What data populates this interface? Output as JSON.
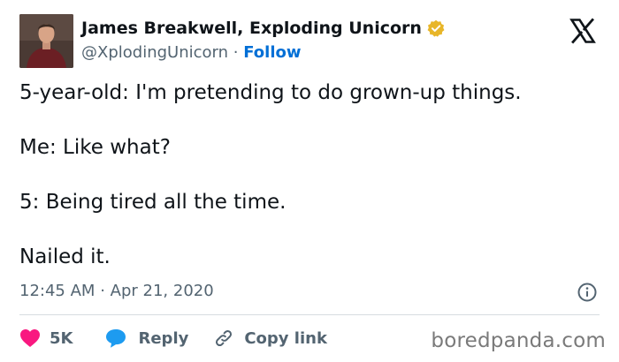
{
  "author": {
    "display_name": "James Breakwell, Exploding Unicorn",
    "handle": "@XplodingUnicorn",
    "separator": "·",
    "follow_label": "Follow",
    "verified_color": "#e8b629",
    "avatar_icon": "avatar-photo"
  },
  "platform_icon": "x-logo-icon",
  "tweet": {
    "lines": [
      "5-year-old: I'm pretending to do grown-up things.",
      "Me: Like what?",
      "5: Being tired all the time.",
      "Nailed it."
    ],
    "time": "12:45 AM",
    "date_separator": "·",
    "date": "Apr 21, 2020"
  },
  "actions": {
    "like_count": "5K",
    "reply_label": "Reply",
    "copy_link_label": "Copy link"
  },
  "colors": {
    "like_heart": "#f91880",
    "reply_bubble": "#1d9bf0",
    "follow_link": "#006fd6"
  },
  "watermark": "boredpanda.com"
}
